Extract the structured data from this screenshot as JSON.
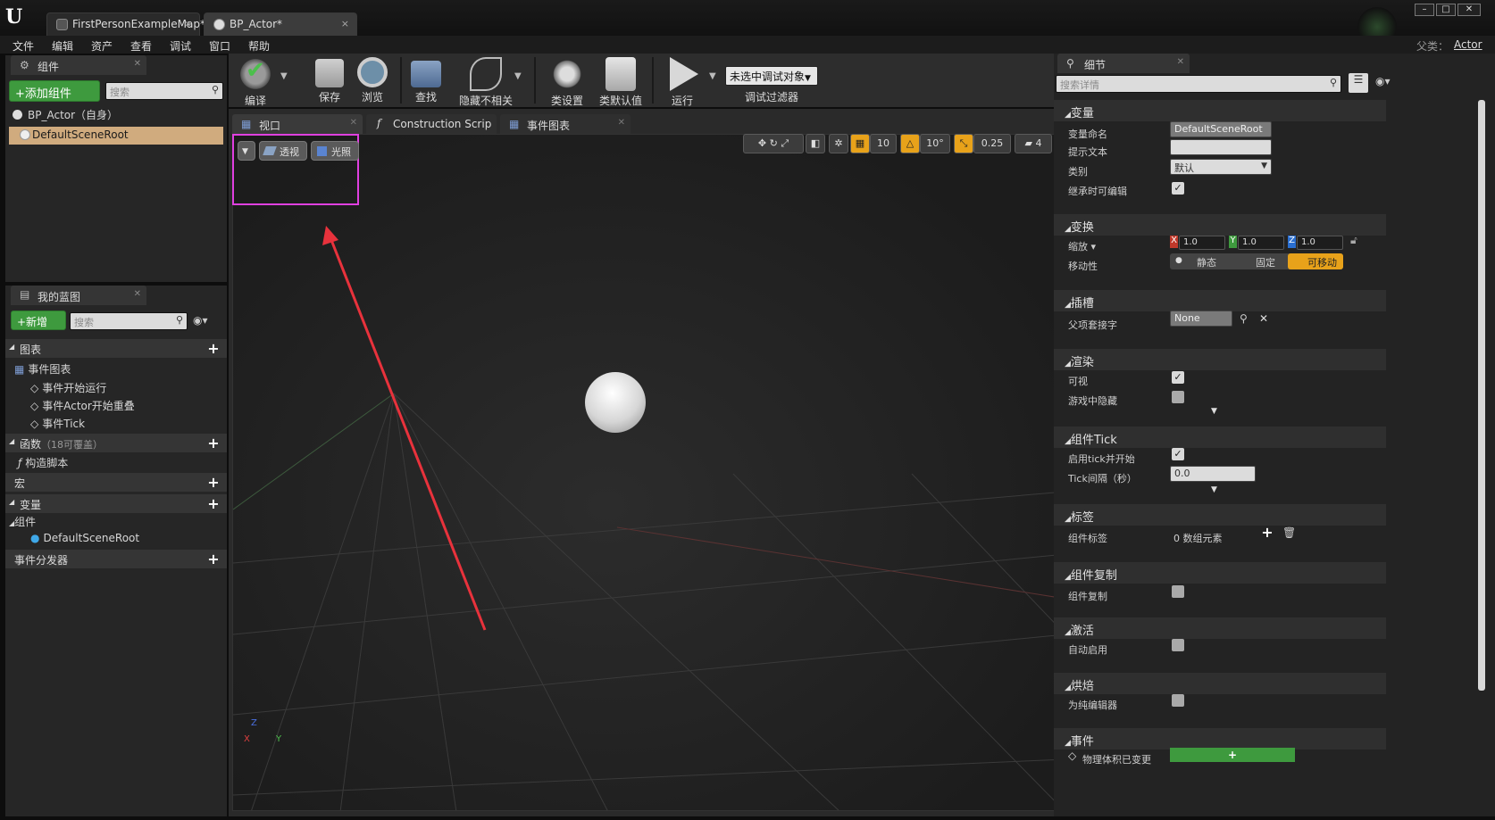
{
  "tabs": [
    {
      "label": "FirstPersonExampleMap*",
      "close": "×"
    },
    {
      "label": "BP_Actor*",
      "close": "×"
    }
  ],
  "menu": [
    "文件",
    "编辑",
    "资产",
    "查看",
    "调试",
    "窗口",
    "帮助"
  ],
  "parent_class": {
    "label": "父类：",
    "value": "Actor"
  },
  "components_panel": {
    "title": "组件",
    "add_button": "+添加组件",
    "search_placeholder": "搜索",
    "root_item": "BP_Actor（自身）",
    "child_item": "DefaultSceneRoot"
  },
  "my_blueprint": {
    "title": "我的蓝图",
    "new_button": "+新增",
    "search_placeholder": "搜索",
    "graphs": "图表",
    "event_graph": "事件图表",
    "events": [
      "事件开始运行",
      "事件Actor开始重叠",
      "事件Tick"
    ],
    "functions": "函数",
    "functions_count": "（18可覆盖）",
    "construction_script": "构造脚本",
    "macros": "宏",
    "variables": "变量",
    "components": "组件",
    "component_item": "DefaultSceneRoot",
    "event_dispatchers": "事件分发器"
  },
  "toolbar": {
    "compile": "编译",
    "save": "保存",
    "browse": "浏览",
    "find": "查找",
    "hide_unrelated": "隐藏不相关",
    "class_settings": "类设置",
    "class_defaults": "类默认值",
    "play": "运行",
    "debug_select": "未选中调试对象",
    "debug_filter": "调试过滤器"
  },
  "editor_tabs": [
    "视口",
    "Construction Scrip",
    "事件图表"
  ],
  "viewport": {
    "perspective": "透视",
    "lit": "光照",
    "grid_snap": "10",
    "rot_snap": "10°",
    "scale_snap": "0.25",
    "cam_speed": "4",
    "axis_z": "Z",
    "axis_y": "Y",
    "axis_x": "X"
  },
  "details": {
    "title": "细节",
    "search_placeholder": "搜索详情",
    "variable": {
      "header": "变量",
      "name_label": "变量命名",
      "name_value": "DefaultSceneRoot",
      "tooltip_label": "提示文本",
      "tooltip_value": "",
      "category_label": "类别",
      "category_value": "默认",
      "editable_label": "继承时可编辑"
    },
    "transform": {
      "header": "变换",
      "scale_label": "缩放",
      "scale": [
        "1.0",
        "1.0",
        "1.0"
      ],
      "mobility_label": "移动性",
      "mobility": [
        "静态",
        "固定",
        "可移动"
      ],
      "axis_names": [
        "X",
        "Y",
        "Z"
      ]
    },
    "sockets": {
      "header": "插槽",
      "parent_socket_label": "父项套接字",
      "parent_socket_value": "None"
    },
    "rendering": {
      "header": "渲染",
      "visible_label": "可视",
      "hidden_label": "游戏中隐藏"
    },
    "tick": {
      "header": "组件Tick",
      "start_label": "启用tick并开始",
      "interval_label": "Tick间隔（秒）",
      "interval_value": "0.0"
    },
    "tags": {
      "header": "标签",
      "label": "组件标签",
      "value": "0 数组元素"
    },
    "replication": {
      "header": "组件复制",
      "label": "组件复制"
    },
    "activation": {
      "header": "激活",
      "label": "自动启用"
    },
    "cooking": {
      "header": "烘焙",
      "label": "为纯编辑器"
    },
    "events": {
      "header": "事件",
      "label": "物理体积已变更",
      "button": "+"
    }
  },
  "colors": {
    "highlight_box": "#e040e0",
    "arrow": "#e8323c",
    "selected_row": "#d0ab7e",
    "green": "#3e9a3e",
    "orange": "#e8a21a"
  }
}
